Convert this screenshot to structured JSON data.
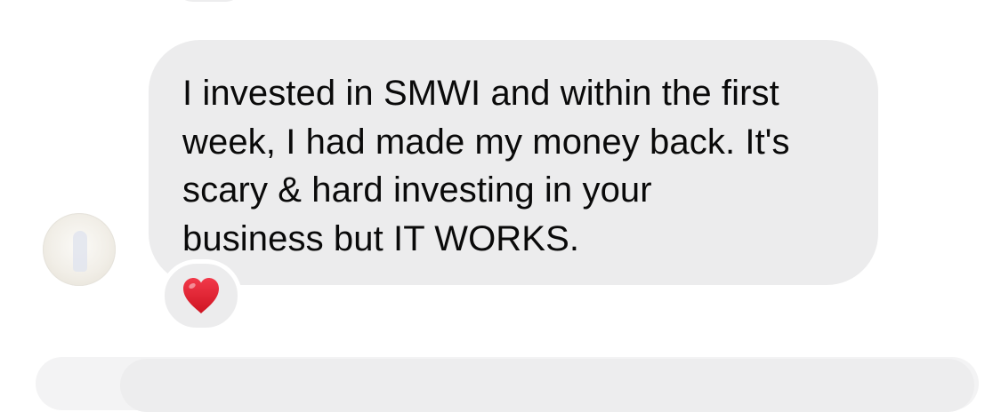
{
  "message": {
    "text": "I invested in SMWI and within the first\nweek, I had made my money back. It's\nscary & hard investing in your\nbusiness but IT WORKS.",
    "reaction": "heart-icon",
    "bubble_color": "#ececed",
    "reaction_color": "#e0202d"
  }
}
